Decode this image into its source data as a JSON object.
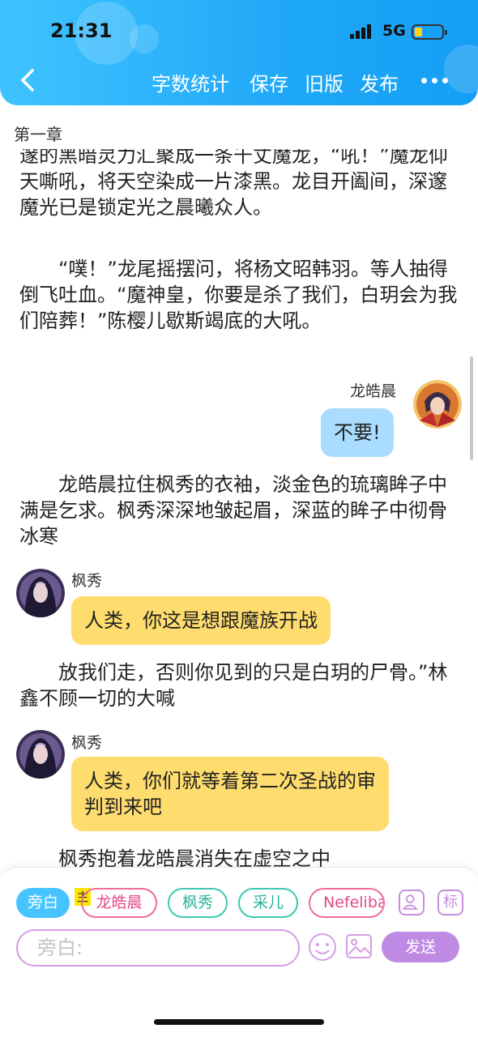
{
  "status_bar": {
    "time": "21:31",
    "network": "5G"
  },
  "header": {
    "back_icon": "chevron-left-icon",
    "actions": [
      "字数统计",
      "保存",
      "旧版",
      "发布"
    ],
    "more_icon": "more-dots-icon"
  },
  "chapter_title": "第一章",
  "content": {
    "para1_partial": "邃的黑暗灵力汇聚成一条千丈魔龙，“吼！”魔龙仰天嘶吼，将天空染成一片漆黑。龙目开阖间，深邃魔光已是锁定光之晨曦众人。",
    "para2": "　　“噗！”龙尾摇摆问，将杨文昭韩羽。等人抽得倒飞吐血。“魔神皇，你要是杀了我们，白玥会为我们陪葬！”陈樱儿歇斯竭底的大吼。",
    "msg1": {
      "speaker": "龙皓晨",
      "text": "不要!"
    },
    "para3": "　　龙皓晨拉住枫秀的衣袖，淡金色的琉璃眸子中满是乞求。枫秀深深地皱起眉，深蓝的眸子中彻骨冰寒",
    "msg2": {
      "speaker": "枫秀",
      "text": "人类，你这是想跟魔族开战"
    },
    "para4": "　　放我们走，否则你见到的只是白玥的尸骨。”林鑫不顾一切的大喊",
    "msg3": {
      "speaker": "枫秀",
      "text": "人类，你们就等着第二次圣战的审判到来吧"
    },
    "para5_partial": "　　枫秀抱着龙皓晨消失在虚空之中"
  },
  "toolbar": {
    "narrator_chip": "旁白",
    "main_tag": "主",
    "characters": [
      "龙皓晨",
      "枫秀",
      "采儿",
      "Nefeliba"
    ],
    "person_icon": "person-icon",
    "tag_icon_label": "标",
    "input_placeholder": "旁白:",
    "emoji_icon": "smile-icon",
    "image_icon": "image-icon",
    "send_label": "发送"
  },
  "colors": {
    "header_blue": "#1fa8f7",
    "bubble_blue": "#a9dcff",
    "bubble_yellow": "#ffdc6e",
    "send_purple": "#bf8ae4",
    "chip_pink": "#e24a88",
    "chip_teal": "#2ab29c"
  }
}
